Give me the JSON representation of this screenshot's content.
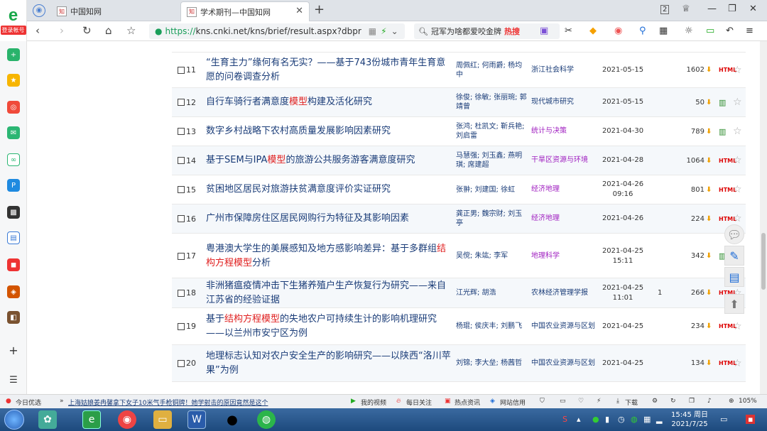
{
  "browser": {
    "logo_label": "登录帐号",
    "tabs": [
      {
        "label": "中国知网",
        "favicon": "知"
      },
      {
        "label": "学术期刊—中国知网",
        "favicon": "知"
      }
    ],
    "url_https": "https://",
    "url_rest": "kns.cnki.net/kns/brief/result.aspx?dbpr",
    "search_text": "冠军为啥都爱咬金牌",
    "search_badge": "热搜"
  },
  "results": [
    {
      "num": "11",
      "title_parts": [
        {
          "t": "“生育主力”缘何有名无实？——基于743份城市青年生育意愿的问卷调查分析",
          "hl": false
        }
      ],
      "authors": "周佩红; 何雨爵; 杨均中",
      "source": "浙江社会科学",
      "source_style": "normal",
      "date": "2021-05-15",
      "cite": "",
      "downloads": "1602",
      "format": "HTML"
    },
    {
      "num": "12",
      "title_parts": [
        {
          "t": "自行车骑行者满意度",
          "hl": false
        },
        {
          "t": "模型",
          "hl": true
        },
        {
          "t": "构建及活化研究",
          "hl": false
        }
      ],
      "authors": "徐俊; 徐敏; 张丽琬; 郭靖曾",
      "source": "现代城市研究",
      "source_style": "normal",
      "date": "2021-05-15",
      "cite": "",
      "downloads": "50",
      "format": "book"
    },
    {
      "num": "13",
      "title_parts": [
        {
          "t": "数字乡村战略下农村高质量发展影响因素研究",
          "hl": false
        }
      ],
      "authors": "张鸿; 杜凯文; 靳兵艳; 刘启雷",
      "source": "统计与决策",
      "source_style": "purple",
      "date": "2021-04-30",
      "cite": "",
      "downloads": "789",
      "format": "book"
    },
    {
      "num": "14",
      "title_parts": [
        {
          "t": "基于SEM与IPA",
          "hl": false
        },
        {
          "t": "模型",
          "hl": true
        },
        {
          "t": "的旅游公共服务游客满意度研究",
          "hl": false
        }
      ],
      "authors": "马慧强; 刘玉鑫; 燕明琪; 席建超",
      "source": "干旱区资源与环境",
      "source_style": "purple",
      "date": "2021-04-28",
      "cite": "",
      "downloads": "1064",
      "format": "HTML"
    },
    {
      "num": "15",
      "title_parts": [
        {
          "t": "贫困地区居民对旅游扶贫满意度评价实证研究",
          "hl": false
        }
      ],
      "authors": "张翀; 刘建国; 徐虹",
      "source": "经济地理",
      "source_style": "purple",
      "date": "2021-04-26 09:16",
      "cite": "",
      "downloads": "801",
      "format": "HTML"
    },
    {
      "num": "16",
      "title_parts": [
        {
          "t": "广州市保障房住区居民网购行为特征及其影响因素",
          "hl": false
        }
      ],
      "authors": "龚正男; 魏宗财; 刘玉亭",
      "source": "经济地理",
      "source_style": "purple",
      "date": "2021-04-26",
      "cite": "",
      "downloads": "224",
      "format": "HTML"
    },
    {
      "num": "17",
      "title_parts": [
        {
          "t": "粤港澳大学生的美展感知及地方感影响差异：基于多群组",
          "hl": false
        },
        {
          "t": "结构方程模型",
          "hl": true
        },
        {
          "t": "分析",
          "hl": false
        }
      ],
      "authors": "吴傥; 朱竑; 李军",
      "source": "地理科学",
      "source_style": "purple",
      "date": "2021-04-25 15:11",
      "cite": "",
      "downloads": "342",
      "format": "book"
    },
    {
      "num": "18",
      "title_parts": [
        {
          "t": "非洲猪瘟疫情冲击下生猪养殖户生产恢复行为研究——来自江苏省的经验证据",
          "hl": false
        }
      ],
      "authors": "江光辉; 胡浩",
      "source": "农林经济管理学报",
      "source_style": "normal",
      "date": "2021-04-25 11:01",
      "cite": "1",
      "downloads": "266",
      "format": "HTML"
    },
    {
      "num": "19",
      "title_parts": [
        {
          "t": "基于",
          "hl": false
        },
        {
          "t": "结构方程模型",
          "hl": true
        },
        {
          "t": "的失地农户可持续生计的影响机理研究——以兰州市安宁区为例",
          "hl": false
        }
      ],
      "authors": "杨琨; 侯庆丰; 刘鹏飞",
      "source": "中国农业资源与区划",
      "source_style": "normal",
      "date": "2021-04-25",
      "cite": "",
      "downloads": "234",
      "format": "HTML"
    },
    {
      "num": "20",
      "title_parts": [
        {
          "t": "地理标志认知对农户安全生产的影响研究——以陕西“洛川苹果”为例",
          "hl": false
        }
      ],
      "authors": "刘锦; 李大垒; 杨茜哲",
      "source": "中国农业资源与区划",
      "source_style": "normal",
      "date": "2021-04-25",
      "cite": "",
      "downloads": "134",
      "format": "HTML"
    }
  ],
  "statusbar": {
    "today": "今日优选",
    "news": "上海姑娘姜冉馨拿下女子10米气手枪铜牌！她学射击的原因竟然是这个",
    "video": "我的视频",
    "daily": "每日关注",
    "hotnews": "热点资讯",
    "credit": "网站信用",
    "download": "下载",
    "zoom": "105%"
  },
  "taskbar": {
    "time": "15:45 周日",
    "date": "2021/7/25"
  }
}
